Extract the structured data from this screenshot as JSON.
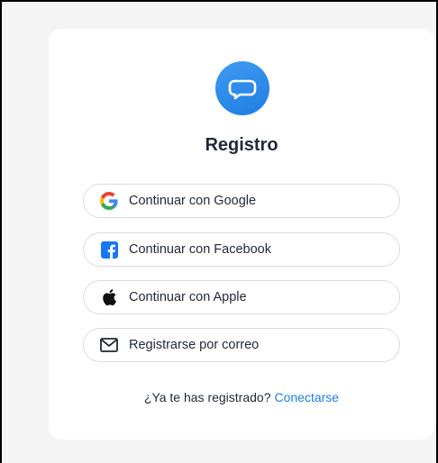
{
  "title": "Registro",
  "buttons": {
    "google": {
      "label": "Continuar con Google",
      "icon": "google-icon"
    },
    "facebook": {
      "label": "Continuar con Facebook",
      "icon": "facebook-icon"
    },
    "apple": {
      "label": "Continuar con Apple",
      "icon": "apple-icon"
    },
    "email": {
      "label": "Registrarse por correo",
      "icon": "envelope-icon"
    }
  },
  "footer": {
    "question": "¿Ya te has registrado?",
    "link": "Conectarse"
  },
  "colors": {
    "accent": "#1b80e0",
    "logo": "#2b88e8",
    "facebook": "#1877f2",
    "google_blue": "#4285f4",
    "google_red": "#ea4335",
    "google_yellow": "#fbbc05",
    "google_green": "#34a853"
  }
}
